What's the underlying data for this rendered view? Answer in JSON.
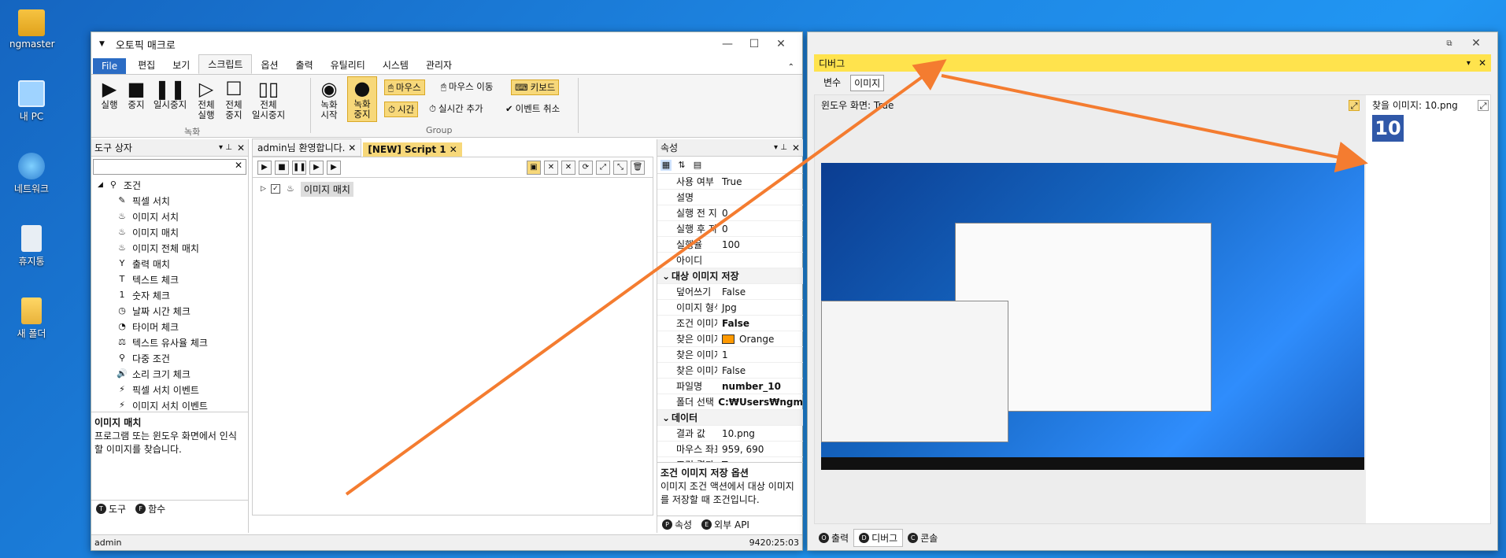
{
  "desktop": {
    "icons": [
      {
        "label": "ngmaster",
        "icon": "user-folder-icon"
      },
      {
        "label": "내 PC",
        "icon": "computer-icon"
      },
      {
        "label": "네트워크",
        "icon": "network-icon"
      },
      {
        "label": "휴지통",
        "icon": "recycle-bin-icon"
      },
      {
        "label": "새 폴더",
        "icon": "folder-icon"
      }
    ]
  },
  "main_window": {
    "title": "오토픽 매크로",
    "menu_tabs": [
      "File",
      "편집",
      "보기",
      "스크립트",
      "옵션",
      "출력",
      "유틸리티",
      "시스템",
      "관리자"
    ],
    "ribbon": {
      "record_group": {
        "label": "녹화",
        "buttons": [
          "실행",
          "중지",
          "일시중지",
          "전체\n실행",
          "전체\n중지",
          "전체\n일시중지"
        ]
      },
      "group_group": {
        "label": "Group",
        "buttons": [
          "녹화\n시작",
          "녹화\n중지"
        ],
        "small": [
          "마우스",
          "마우스 이동",
          "키보드",
          "시간",
          "실시간 추가",
          "이벤트 취소"
        ]
      }
    },
    "toolbox": {
      "title": "도구 상자",
      "root": "조건",
      "items": [
        "픽셀 서치",
        "이미지 서치",
        "이미지 매치",
        "이미지 전체 매치",
        "출력 매치",
        "텍스트 체크",
        "숫자 체크",
        "날짜 시간 체크",
        "타이머 체크",
        "텍스트 유사율 체크",
        "다중 조건",
        "소리 크기 체크",
        "픽셀 서치 이벤트",
        "이미지 서치 이벤트"
      ],
      "desc_title": "이미지 매치",
      "desc_text": "프로그램 또는 윈도우 화면에서 인식할 이미지를 찾습니다.",
      "tabs": [
        "도구",
        "함수"
      ]
    },
    "editor": {
      "tabs": [
        "admin님 환영합니다.",
        "[NEW] Script 1"
      ],
      "tree_node": "이미지 매치"
    },
    "properties": {
      "title": "속성",
      "rows": [
        {
          "k": "사용 여부",
          "v": "True"
        },
        {
          "k": "설명",
          "v": ""
        },
        {
          "k": "실행 전 지연",
          "v": "0"
        },
        {
          "k": "실행 후 지연",
          "v": "0"
        },
        {
          "k": "실행율",
          "v": "100"
        },
        {
          "k": "아이디",
          "v": ""
        }
      ],
      "cat1": "대상 이미지 저장",
      "rows2": [
        {
          "k": "덮어쓰기",
          "v": "False"
        },
        {
          "k": "이미지 형식",
          "v": "Jpg"
        },
        {
          "k": "조건 이미지",
          "v": "False"
        },
        {
          "k": "찾은 이미지",
          "v": "Orange"
        },
        {
          "k": "찾은 이미지",
          "v": "1"
        },
        {
          "k": "찾은 이미지",
          "v": "False"
        },
        {
          "k": "파일명",
          "v": "number_10"
        },
        {
          "k": "폴더 선택",
          "v": "C:₩Users₩ngm"
        }
      ],
      "cat2": "데이터",
      "rows3": [
        {
          "k": "결과 값",
          "v": "10.png"
        },
        {
          "k": "마우스 좌표",
          "v": "959, 690"
        },
        {
          "k": "조건 결과",
          "v": "True"
        }
      ],
      "desc_title": "조건 이미지 저장 옵션",
      "desc_text": "이미지 조건 액션에서 대상 이미지를 저장할 때 조건입니다.",
      "tabs": [
        "속성",
        "외부 API"
      ]
    },
    "status": {
      "user": "admin",
      "time": "9420:25:03"
    }
  },
  "debug_window": {
    "title": "디버그",
    "tabs": [
      "변수",
      "이미지"
    ],
    "left_label": "윈도우 화면: True",
    "right_label": "찾을 이미지: 10.png",
    "found_image": "10",
    "bottom_tabs": [
      "출력",
      "디버그",
      "콘솔"
    ]
  },
  "colors": {
    "arrow": "#f47c30",
    "accent": "#2b6cc4",
    "highlight": "#f7d87a",
    "debug_bar": "#ffe34d"
  }
}
